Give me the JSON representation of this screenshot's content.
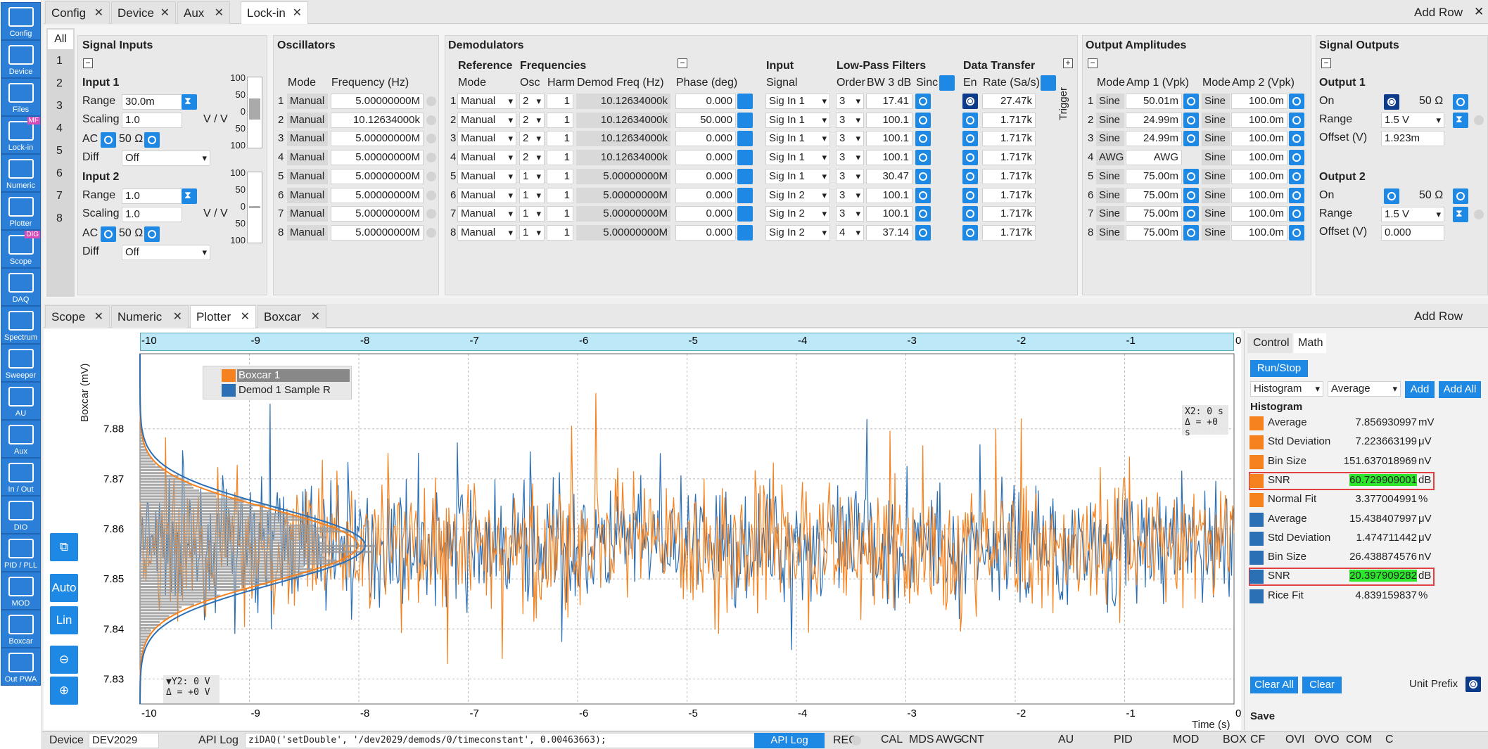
{
  "sidebar": {
    "items": [
      {
        "label": "Config",
        "icon": "gear-icon"
      },
      {
        "label": "Device",
        "icon": "device-icon"
      },
      {
        "label": "Files",
        "icon": "folder-icon"
      },
      {
        "label": "Lock-in",
        "icon": "lockin-icon",
        "badge": "MF"
      },
      {
        "label": "Numeric",
        "icon": "numeric-icon"
      },
      {
        "label": "Plotter",
        "icon": "plotter-icon"
      },
      {
        "label": "Scope",
        "icon": "scope-icon",
        "badge": "DIG"
      },
      {
        "label": "DAQ",
        "icon": "daq-icon"
      },
      {
        "label": "Spectrum",
        "icon": "spectrum-icon"
      },
      {
        "label": "Sweeper",
        "icon": "sweeper-icon"
      },
      {
        "label": "AU",
        "icon": "au-icon"
      },
      {
        "label": "Aux",
        "icon": "aux-icon"
      },
      {
        "label": "In / Out",
        "icon": "inout-icon"
      },
      {
        "label": "DIO",
        "icon": "dio-icon"
      },
      {
        "label": "PID / PLL",
        "icon": "pid-icon"
      },
      {
        "label": "MOD",
        "icon": "mod-icon"
      },
      {
        "label": "Boxcar",
        "icon": "boxcar-icon"
      },
      {
        "label": "Out PWA",
        "icon": "pwa-icon"
      }
    ]
  },
  "top_tabs": [
    "Config",
    "Device",
    "Aux",
    "Lock-in"
  ],
  "add_row": "Add Row",
  "lockin": {
    "all": "All",
    "rows": [
      "1",
      "2",
      "3",
      "4",
      "5",
      "6",
      "7",
      "8"
    ],
    "signal_inputs": {
      "title": "Signal Inputs",
      "input1": "Input 1",
      "input2": "Input 2",
      "range": "Range",
      "scaling": "Scaling",
      "ac": "AC",
      "ohm": "50 Ω",
      "diff": "Diff",
      "in1_range": "30.0m",
      "in1_scaling": "1.0",
      "unit": "V / V",
      "in1_diff": "Off",
      "in2_range": "1.0",
      "in2_scaling": "1.0",
      "in2_diff": "Off",
      "scale_ticks": [
        "100",
        "50",
        "0",
        "50",
        "100"
      ]
    },
    "oscillators": {
      "title": "Oscillators",
      "mode_hdr": "Mode",
      "freq_hdr": "Frequency (Hz)",
      "rows": [
        {
          "mode": "Manual",
          "freq": "5.00000000M"
        },
        {
          "mode": "Manual",
          "freq": "10.12634000k"
        },
        {
          "mode": "Manual",
          "freq": "5.00000000M"
        },
        {
          "mode": "Manual",
          "freq": "5.00000000M"
        },
        {
          "mode": "Manual",
          "freq": "5.00000000M"
        },
        {
          "mode": "Manual",
          "freq": "5.00000000M"
        },
        {
          "mode": "Manual",
          "freq": "5.00000000M"
        },
        {
          "mode": "Manual",
          "freq": "5.00000000M"
        }
      ]
    },
    "demodulators": {
      "title": "Demodulators",
      "reference": "Reference",
      "frequencies": "Frequencies",
      "mode_hdr": "Mode",
      "osc_hdr": "Osc",
      "harm_hdr": "Harm",
      "demod_hdr": "Demod Freq (Hz)",
      "phase_hdr": "Phase (deg)",
      "input": "Input",
      "signal_hdr": "Signal",
      "lpf": "Low-Pass Filters",
      "order_hdr": "Order",
      "bw_hdr": "BW 3 dB",
      "sinc_hdr": "Sinc",
      "dt": "Data Transfer",
      "en_hdr": "En",
      "rate_hdr": "Rate (Sa/s)",
      "trigger": "Trigger",
      "rows": [
        {
          "mode": "Manual",
          "osc": "2",
          "harm": "1",
          "demod": "10.12634000k",
          "phase": "0.000",
          "signal": "Sig In 1",
          "order": "3",
          "bw": "17.41",
          "rate": "27.47k"
        },
        {
          "mode": "Manual",
          "osc": "2",
          "harm": "1",
          "demod": "10.12634000k",
          "phase": "50.000",
          "signal": "Sig In 1",
          "order": "3",
          "bw": "100.1",
          "rate": "1.717k"
        },
        {
          "mode": "Manual",
          "osc": "2",
          "harm": "1",
          "demod": "10.12634000k",
          "phase": "0.000",
          "signal": "Sig In 1",
          "order": "3",
          "bw": "100.1",
          "rate": "1.717k"
        },
        {
          "mode": "Manual",
          "osc": "2",
          "harm": "1",
          "demod": "10.12634000k",
          "phase": "0.000",
          "signal": "Sig In 1",
          "order": "3",
          "bw": "100.1",
          "rate": "1.717k"
        },
        {
          "mode": "Manual",
          "osc": "1",
          "harm": "1",
          "demod": "5.00000000M",
          "phase": "0.000",
          "signal": "Sig In 1",
          "order": "3",
          "bw": "30.47",
          "rate": "1.717k"
        },
        {
          "mode": "Manual",
          "osc": "1",
          "harm": "1",
          "demod": "5.00000000M",
          "phase": "0.000",
          "signal": "Sig In 2",
          "order": "3",
          "bw": "100.1",
          "rate": "1.717k"
        },
        {
          "mode": "Manual",
          "osc": "1",
          "harm": "1",
          "demod": "5.00000000M",
          "phase": "0.000",
          "signal": "Sig In 2",
          "order": "3",
          "bw": "100.1",
          "rate": "1.717k"
        },
        {
          "mode": "Manual",
          "osc": "1",
          "harm": "1",
          "demod": "5.00000000M",
          "phase": "0.000",
          "signal": "Sig In 2",
          "order": "4",
          "bw": "37.14",
          "rate": "1.717k"
        }
      ]
    },
    "output_amps": {
      "title": "Output Amplitudes",
      "mode_hdr": "Mode",
      "amp1_hdr": "Amp 1 (Vpk)",
      "amp2_hdr": "Amp 2 (Vpk)",
      "rows": [
        {
          "m1": "Sine",
          "a1": "50.01m",
          "m2": "Sine",
          "a2": "100.0m"
        },
        {
          "m1": "Sine",
          "a1": "24.99m",
          "m2": "Sine",
          "a2": "100.0m"
        },
        {
          "m1": "Sine",
          "a1": "24.99m",
          "m2": "Sine",
          "a2": "100.0m"
        },
        {
          "m1": "AWG",
          "a1": "AWG",
          "m2": "Sine",
          "a2": "100.0m"
        },
        {
          "m1": "Sine",
          "a1": "75.00m",
          "m2": "Sine",
          "a2": "100.0m"
        },
        {
          "m1": "Sine",
          "a1": "75.00m",
          "m2": "Sine",
          "a2": "100.0m"
        },
        {
          "m1": "Sine",
          "a1": "75.00m",
          "m2": "Sine",
          "a2": "100.0m"
        },
        {
          "m1": "Sine",
          "a1": "75.00m",
          "m2": "Sine",
          "a2": "100.0m"
        }
      ]
    },
    "signal_outputs": {
      "title": "Signal Outputs",
      "out1": "Output 1",
      "out2": "Output 2",
      "on": "On",
      "ohm": "50 Ω",
      "range": "Range",
      "offset": "Offset (V)",
      "out1_range": "1.5 V",
      "out1_offset": "1.923m",
      "out2_range": "1.5 V",
      "out2_offset": "0.000"
    }
  },
  "bottom_tabs": [
    "Scope",
    "Numeric",
    "Plotter",
    "Boxcar"
  ],
  "plot": {
    "ylabel": "Boxcar (mV)",
    "xlabel": "Time (s)",
    "legend": [
      "Boxcar 1",
      "Demod 1 Sample R"
    ],
    "cursor_x": "X2: 0 s",
    "cursor_dx": "Δ = +0 s",
    "cursor_y": "▼Y2: 0 V",
    "cursor_dy": "Δ = +0 V",
    "auto": "Auto",
    "lin": "Lin"
  },
  "chart_data": {
    "type": "line",
    "xlabel": "Time (s)",
    "ylabel": "Boxcar (mV)",
    "xlim": [
      -10,
      0
    ],
    "ylim": [
      7.825,
      7.895
    ],
    "xticks": [
      "-10",
      "-9",
      "-8",
      "-7",
      "-6",
      "-5",
      "-4",
      "-3",
      "-2",
      "-1",
      "0"
    ],
    "yticks": [
      "7.83",
      "7.84",
      "7.85",
      "7.86",
      "7.87",
      "7.88"
    ],
    "series": [
      {
        "name": "Boxcar 1",
        "color": "#f5821f"
      },
      {
        "name": "Demod 1 Sample R",
        "color": "#2b6fb5"
      }
    ]
  },
  "math": {
    "tabs": [
      "Control",
      "Math"
    ],
    "run_stop": "Run/Stop",
    "op": "Histogram",
    "stat": "Average",
    "add": "Add",
    "add_all": "Add All",
    "section": "Histogram",
    "rows": [
      {
        "label": "Average",
        "value": "7.856930997",
        "unit": "mV",
        "color": "#f5821f",
        "hl": false
      },
      {
        "label": "Std Deviation",
        "value": "7.223663199",
        "unit": "μV",
        "color": "#f5821f",
        "hl": false
      },
      {
        "label": "Bin Size",
        "value": "151.637018969",
        "unit": "nV",
        "color": "#f5821f",
        "hl": false
      },
      {
        "label": "SNR",
        "value": "60.729909001",
        "unit": "dB",
        "color": "#f5821f",
        "hl": true
      },
      {
        "label": "Normal Fit",
        "value": "3.377004991",
        "unit": "%",
        "color": "#f5821f",
        "hl": false
      },
      {
        "label": "Average",
        "value": "15.438407997",
        "unit": "μV",
        "color": "#2b6fb5",
        "hl": false
      },
      {
        "label": "Std Deviation",
        "value": "1.474711442",
        "unit": "μV",
        "color": "#2b6fb5",
        "hl": false
      },
      {
        "label": "Bin Size",
        "value": "26.438874576",
        "unit": "nV",
        "color": "#2b6fb5",
        "hl": false
      },
      {
        "label": "SNR",
        "value": "20.397909282",
        "unit": "dB",
        "color": "#2b6fb5",
        "hl": true
      },
      {
        "label": "Rice Fit",
        "value": "4.839159837",
        "unit": "%",
        "color": "#2b6fb5",
        "hl": false
      }
    ],
    "clear_all": "Clear All",
    "clear": "Clear",
    "unit_prefix": "Unit Prefix",
    "save": "Save"
  },
  "status": {
    "device_lbl": "Device",
    "device": "DEV2029",
    "api_log": "API Log",
    "api_cmd": "ziDAQ('setDouble', '/dev2029/demods/0/timeconstant', 0.00463663);",
    "api_log_btn": "API Log",
    "rec": "REC",
    "indicators": [
      "CAL",
      "MDS",
      "AWG",
      "CNT",
      "AU",
      "PID",
      "MOD",
      "BOX",
      "CF",
      "OVI",
      "OVO",
      "COM",
      "C"
    ]
  }
}
